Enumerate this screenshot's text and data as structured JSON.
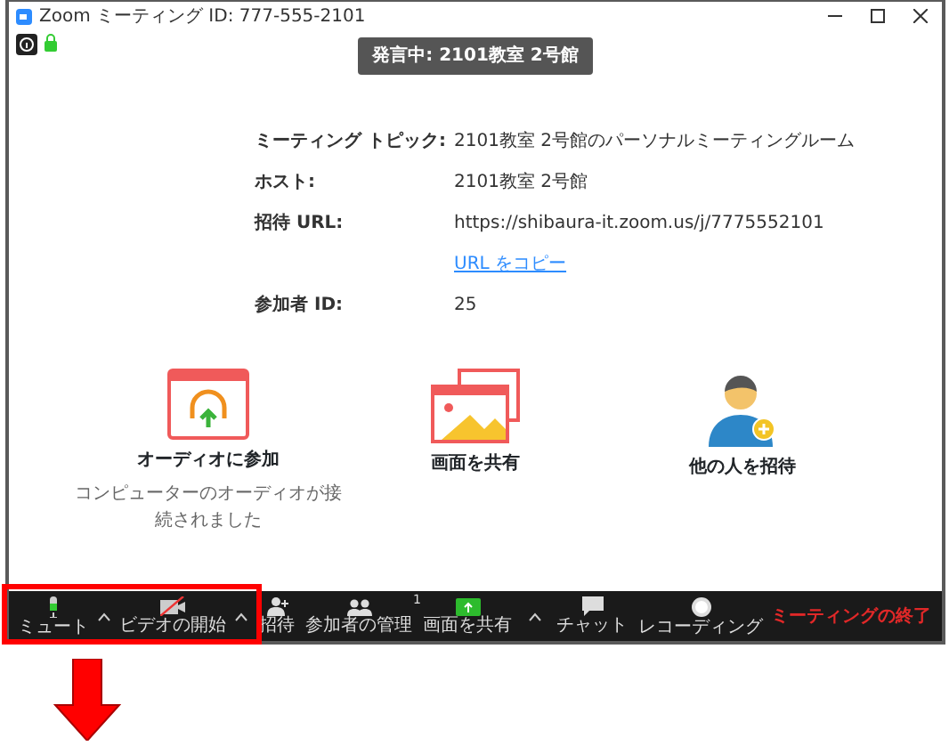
{
  "window": {
    "title": "Zoom ミーティング ID: 777-555-2101"
  },
  "speaker_banner": "発言中: 2101教室 2号館",
  "info": [
    {
      "label": "ミーティング トピック:",
      "value": "2101教室 2号館のパーソナルミーティングルーム"
    },
    {
      "label": "ホスト:",
      "value": "2101教室 2号館"
    },
    {
      "label": "招待 URL:",
      "value": "https://shibaura-it.zoom.us/j/7775552101",
      "link": "URL をコピー"
    },
    {
      "label": "参加者 ID:",
      "value": "25"
    }
  ],
  "actions": [
    {
      "kind": "audio",
      "label": "オーディオに参加",
      "caption": "コンピューターのオーディオが接続されました"
    },
    {
      "kind": "share",
      "label": "画面を共有"
    },
    {
      "kind": "invite",
      "label": "他の人を招待"
    }
  ],
  "toolbar_left": [
    {
      "kind": "mic",
      "label": "ミュート",
      "caret": true
    },
    {
      "kind": "video",
      "label": "ビデオの開始",
      "caret": true
    }
  ],
  "toolbar_center": [
    {
      "kind": "invite",
      "label": "招待",
      "caret": false
    },
    {
      "kind": "participants",
      "label": "参加者の管理",
      "badge": "1",
      "caret": false
    },
    {
      "kind": "share",
      "label": "画面を共有",
      "caret": true
    },
    {
      "kind": "chat",
      "label": "チャット",
      "caret": false
    },
    {
      "kind": "record",
      "label": "レコーディング",
      "caret": false
    }
  ],
  "end_button": "ミーティングの終了"
}
